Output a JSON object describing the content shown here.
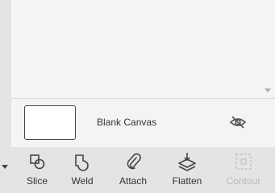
{
  "canvas": {
    "name": "Blank Canvas"
  },
  "toolbar": {
    "tools": [
      {
        "label": "Slice",
        "icon": "slice-icon",
        "enabled": true
      },
      {
        "label": "Weld",
        "icon": "weld-icon",
        "enabled": true
      },
      {
        "label": "Attach",
        "icon": "attach-icon",
        "enabled": true
      },
      {
        "label": "Flatten",
        "icon": "flatten-icon",
        "enabled": true
      },
      {
        "label": "Contour",
        "icon": "contour-icon",
        "enabled": false
      }
    ]
  },
  "colors": {
    "panel_bg": "#f4f4f5",
    "toolbar_bg": "#e4e4e4",
    "text": "#333333",
    "disabled_text": "#b9b9b9"
  }
}
